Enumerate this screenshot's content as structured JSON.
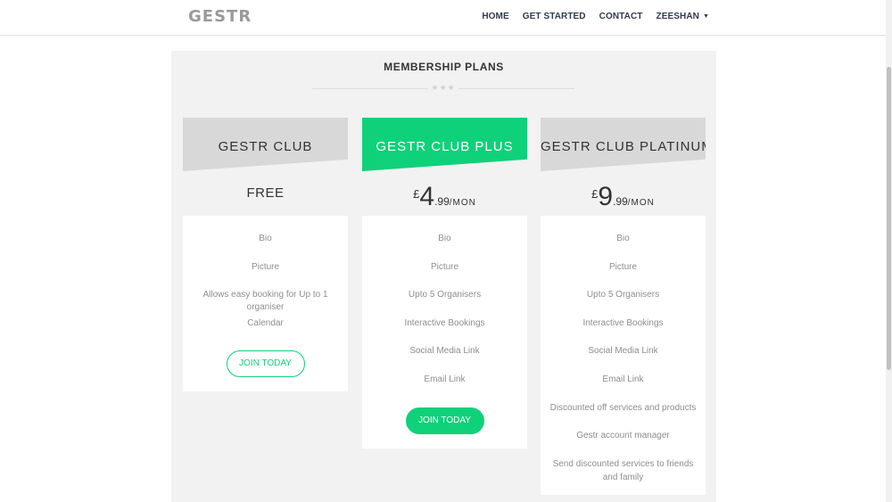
{
  "brand": "GESTR",
  "nav": {
    "items": [
      "HOME",
      "GET STARTED",
      "CONTACT"
    ],
    "user": "ZEESHAN"
  },
  "section": {
    "title": "MEMBERSHIP PLANS",
    "divider_stars": "★★★"
  },
  "plans": [
    {
      "name": "GESTR CLUB",
      "price_text": "FREE",
      "features": [
        "Bio",
        "Picture",
        "Allows easy booking for Up to 1 organiser",
        "Calendar"
      ],
      "button": "JOIN TODAY"
    },
    {
      "name": "GESTR CLUB PLUS",
      "currency": "£",
      "amount": "4",
      "decimals": ".99",
      "period": "/MON",
      "features": [
        "Bio",
        "Picture",
        "Upto 5 Organisers",
        "Interactive Bookings",
        "Social Media Link",
        "Email Link"
      ],
      "button": "JOIN TODAY"
    },
    {
      "name": "GESTR CLUB PLATINUM",
      "currency": "£",
      "amount": "9",
      "decimals": ".99",
      "period": "/MON",
      "features": [
        "Bio",
        "Picture",
        "Upto 5 Organisers",
        "Interactive Bookings",
        "Social Media Link",
        "Email Link",
        "Discounted off services and products",
        "Gestr account manager",
        "Send discounted services to friends and family"
      ]
    }
  ],
  "colors": {
    "accent": "#0fd17a",
    "header_gray": "#d8d8d8",
    "section_bg": "#f2f2f2"
  }
}
